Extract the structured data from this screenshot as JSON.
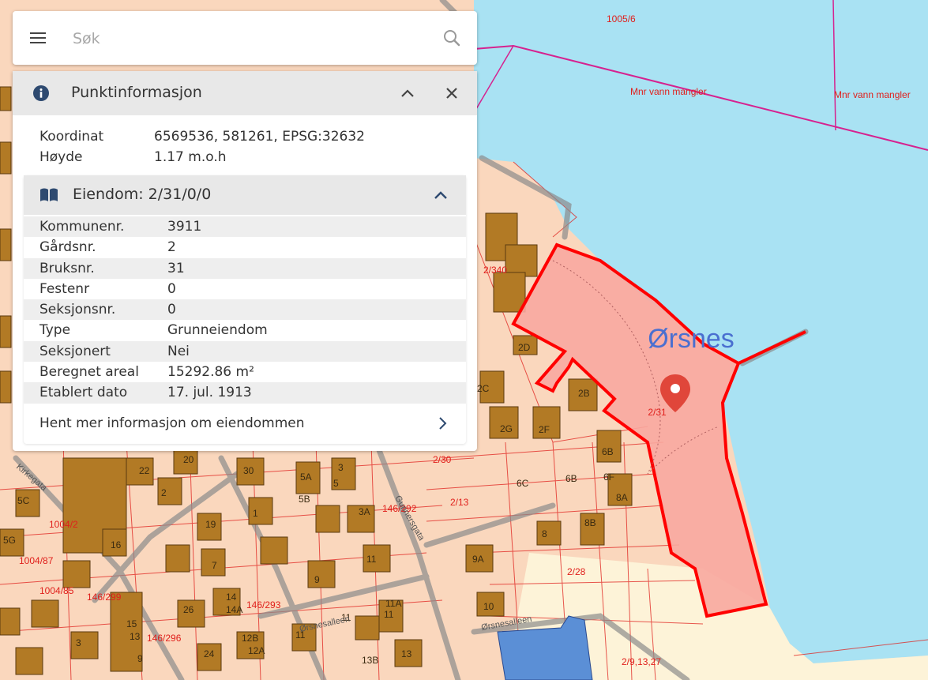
{
  "search": {
    "placeholder": "Søk"
  },
  "panel": {
    "title": "Punktinformasjon",
    "coord_label": "Koordinat",
    "coord_value": "6569536, 581261, EPSG:32632",
    "height_label": "Høyde",
    "height_value": "1.17 m.o.h"
  },
  "property": {
    "title": "Eiendom: 2/31/0/0",
    "rows": [
      {
        "key": "Kommunenr.",
        "value": "3911"
      },
      {
        "key": "Gårdsnr.",
        "value": "2"
      },
      {
        "key": "Bruksnr.",
        "value": "31"
      },
      {
        "key": "Festenr",
        "value": "0"
      },
      {
        "key": "Seksjonsnr.",
        "value": "0"
      },
      {
        "key": "Type",
        "value": "Grunneiendom"
      },
      {
        "key": "Seksjonert",
        "value": "Nei"
      },
      {
        "key": "Beregnet areal",
        "value": "15292.86 m²"
      },
      {
        "key": "Etablert dato",
        "value": "17. jul. 1913"
      }
    ],
    "more_label": "Hent mer informasjon om eiendommen"
  },
  "map": {
    "place_name": "Ørsnes",
    "selected_parcel_label": "2/31",
    "parcel_labels": [
      "1005/6",
      "Mnr vann mangler",
      "Mnr vann mangler",
      "2/340",
      "2/30",
      "2/13",
      "146/292",
      "1004/2",
      "1004/87",
      "1004/85",
      "146/299",
      "146/293",
      "146/296",
      "2/28",
      "2/9,13,27"
    ],
    "building_labels": [
      "2D",
      "2C",
      "2B",
      "2G",
      "2F",
      "6B",
      "6C",
      "6B",
      "6F",
      "8A",
      "8B",
      "8",
      "9A",
      "9",
      "10",
      "11",
      "11A",
      "11",
      "11",
      "12B",
      "12A",
      "13",
      "13B",
      "14",
      "14A",
      "15",
      "13",
      "9",
      "20",
      "24",
      "26",
      "30",
      "3",
      "3A",
      "5",
      "5A",
      "5B",
      "5C",
      "5G",
      "1",
      "2",
      "3",
      "7",
      "11",
      "16",
      "19",
      "22",
      "2",
      "9"
    ],
    "street_labels": [
      "Kirkegata",
      "Ørsnesalleen",
      "Ørsnesalleen",
      "Gunnersgata"
    ],
    "colors": {
      "water": "#a9e2f3",
      "land": "#fad7bd",
      "parcel_line": "#e0201c",
      "selected_fill": "#f8a8a0",
      "selected_outline": "#ff0000",
      "building": "#b27a25",
      "marker": "#e0463a",
      "boundary": "#d6228f"
    }
  }
}
